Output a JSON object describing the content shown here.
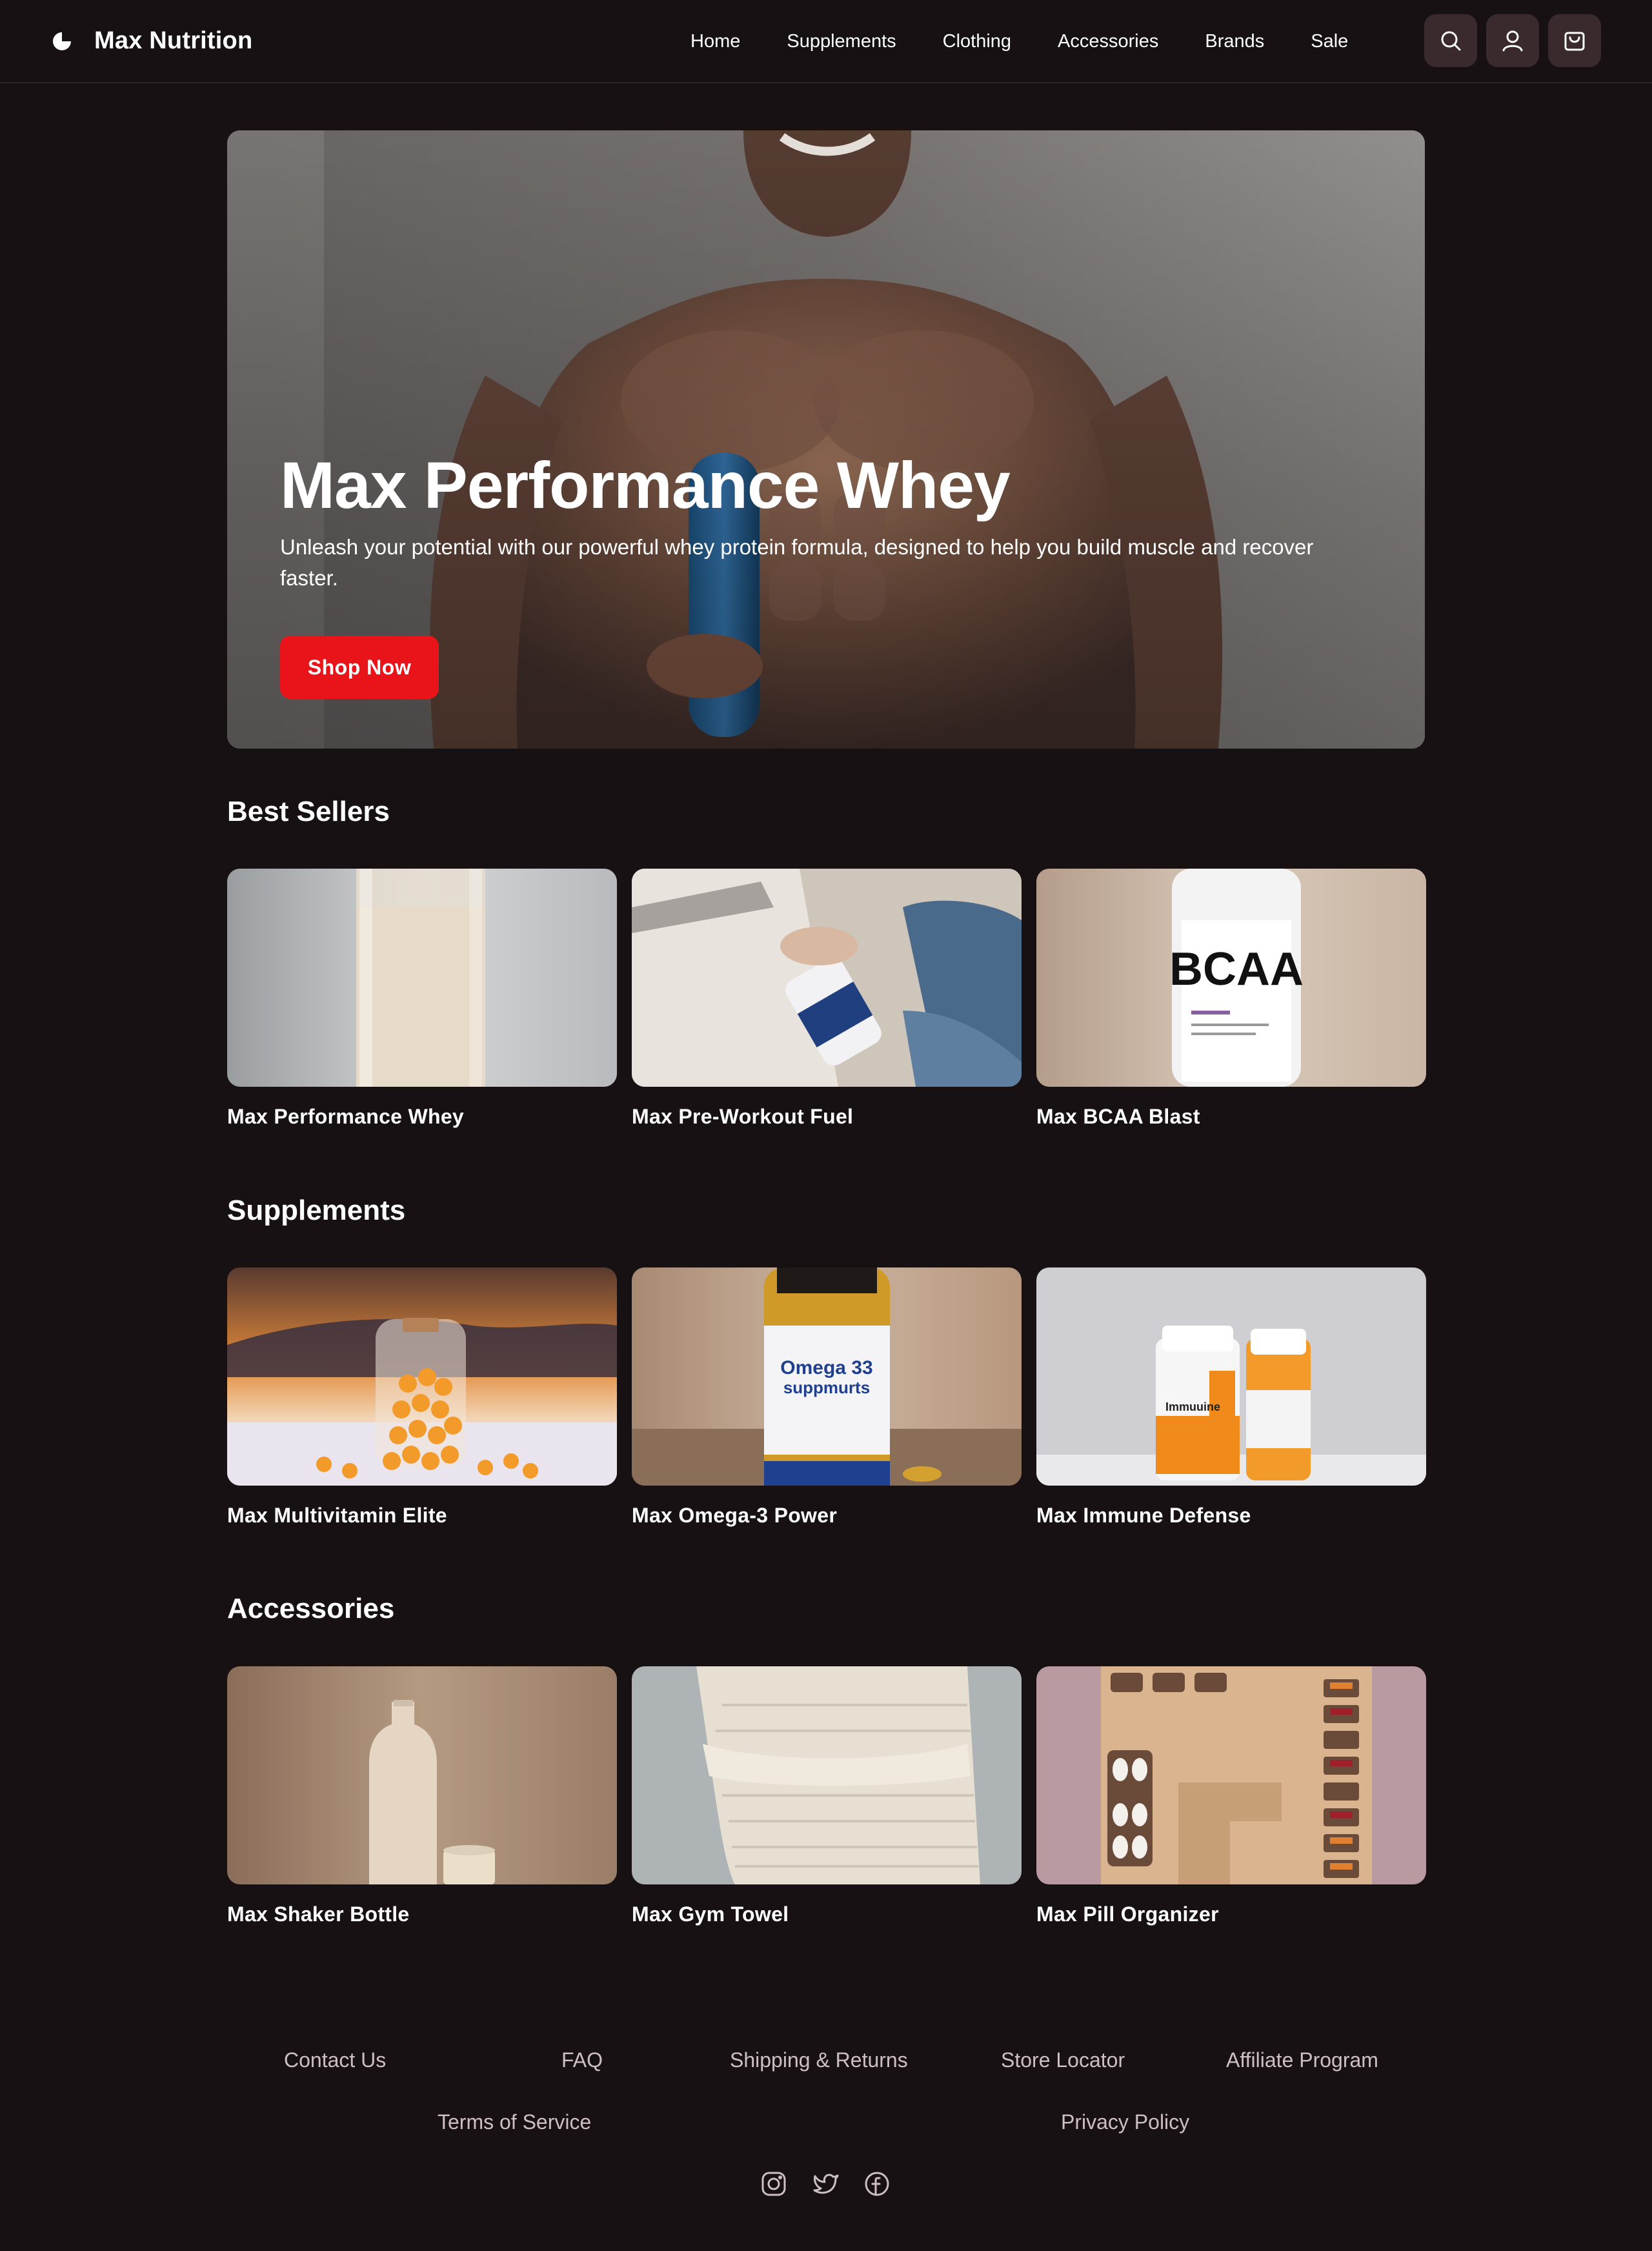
{
  "header": {
    "brand": "Max Nutrition",
    "nav": [
      "Home",
      "Supplements",
      "Clothing",
      "Accessories",
      "Brands",
      "Sale"
    ],
    "icons": [
      "search-icon",
      "user-icon",
      "cart-icon"
    ]
  },
  "hero": {
    "title": "Max Performance Whey",
    "subtitle": "Unleash your potential with our powerful whey protein formula, designed to help you build muscle and recover faster.",
    "cta": "Shop Now"
  },
  "sections": [
    {
      "title": "Best Sellers",
      "products": [
        "Max Performance Whey",
        "Max Pre-Workout Fuel",
        "Max BCAA Blast"
      ]
    },
    {
      "title": "Supplements",
      "products": [
        "Max Multivitamin Elite",
        "Max Omega-3 Power",
        "Max Immune Defense"
      ]
    },
    {
      "title": "Accessories",
      "products": [
        "Max Shaker Bottle",
        "Max Gym Towel",
        "Max Pill Organizer"
      ]
    }
  ],
  "footer": {
    "links": [
      "Contact Us",
      "FAQ",
      "Shipping & Returns",
      "Store Locator",
      "Affiliate Program",
      "Terms of Service",
      "Privacy Policy"
    ],
    "social": [
      "instagram-icon",
      "twitter-icon",
      "facebook-icon"
    ]
  },
  "colors": {
    "background": "#181113",
    "accent": "#e8141a",
    "icon_button": "#3a2a2e",
    "footer_text": "#cdbfc3"
  },
  "product_image_text": {
    "bcaa_label": "BCAA",
    "omega_label": "Omega 33",
    "omega_label2": "suppmurts",
    "immune_label": "Immuuine"
  }
}
